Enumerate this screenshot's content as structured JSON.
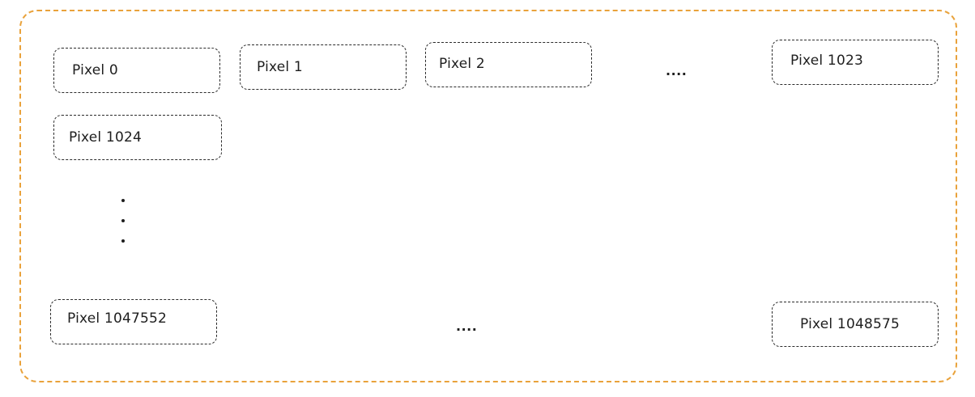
{
  "colors": {
    "outer_border": "#e9a23b",
    "box_border": "#2b2b2b",
    "text": "#1e1e1e"
  },
  "pixels": [
    {
      "label": "Pixel 0"
    },
    {
      "label": "Pixel 1"
    },
    {
      "label": "Pixel 2"
    },
    {
      "label": "Pixel 1023"
    },
    {
      "label": "Pixel 1024"
    },
    {
      "label": "Pixel 1047552"
    },
    {
      "label": "Pixel 1048575"
    }
  ],
  "ellipsis": {
    "row_top": "....",
    "row_bottom": "...."
  }
}
